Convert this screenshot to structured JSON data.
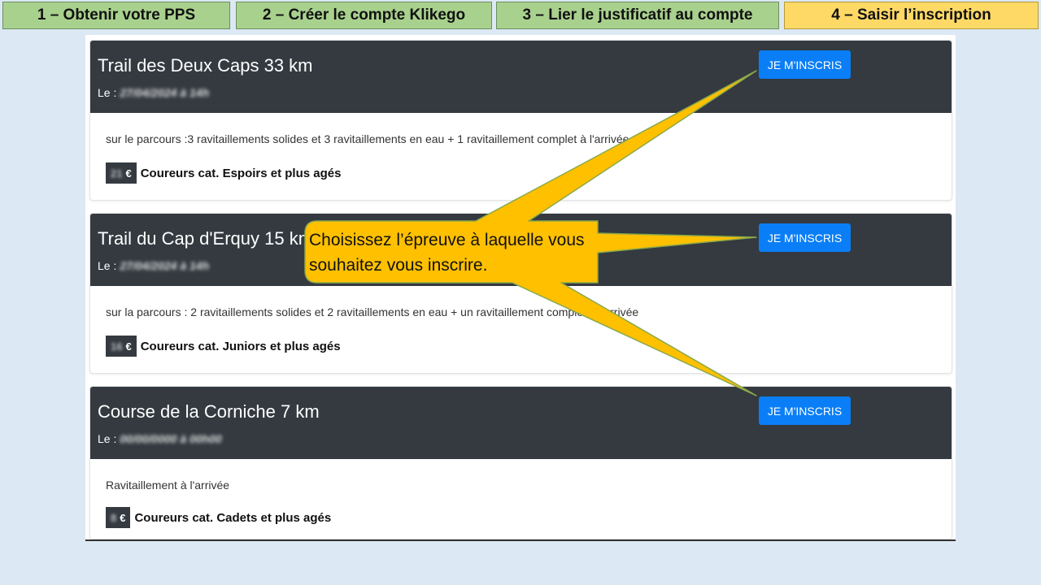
{
  "steps": [
    {
      "label": "1 – Obtenir votre PPS"
    },
    {
      "label": "2 – Créer le compte Klikego"
    },
    {
      "label": "3 – Lier le justificatif au compte"
    },
    {
      "label": "4 – Saisir l’inscription",
      "active": true
    }
  ],
  "date_prefix": "Le :",
  "register_label": "JE M'INSCRIS",
  "currency": "€",
  "events": [
    {
      "title": "Trail des Deux Caps 33 km",
      "date": "27/04/2024 à 14h",
      "description": "sur le parcours :3 ravitaillements solides et 3 ravitaillements en eau + 1 ravitaillement complet à l'arrivée",
      "price": "21",
      "category": "Coureurs cat. Espoirs et plus agés"
    },
    {
      "title": "Trail du Cap d'Erquy 15 km",
      "date": "27/04/2024 à 14h",
      "description": "sur la parcours : 2 ravitaillements solides et 2 ravitaillements en eau + un ravitaillement complet à l'arrivée",
      "price": "16",
      "category": "Coureurs cat. Juniors et plus agés"
    },
    {
      "title": "Course de la Corniche 7 km",
      "date": "00/00/0000 à 00h00",
      "description": "Ravitaillement à l'arrivée",
      "price": "8",
      "category": "Coureurs cat. Cadets et plus agés"
    }
  ],
  "callout": {
    "text": "Choisissez l’épreuve à laquelle vous souhaitez vous inscrire.",
    "fill": "#ffc000",
    "border": "#8aa84a"
  },
  "colors": {
    "step_done": "#a9d18e",
    "step_active": "#ffd966",
    "card_header": "#343a40",
    "button": "#0a7ef6"
  }
}
